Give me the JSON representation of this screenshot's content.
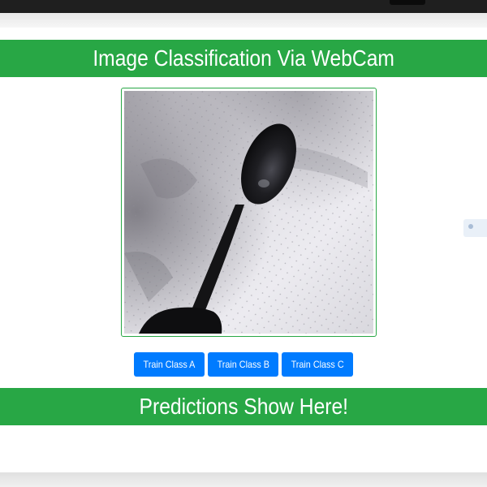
{
  "header": {
    "title": "Image Classification Via WebCam"
  },
  "video": {
    "icon": "webcam-feed"
  },
  "buttons": {
    "train_a": "Train Class A",
    "train_b": "Train Class B",
    "train_c": "Train Class C"
  },
  "predictions": {
    "text": "Predictions Show Here!"
  },
  "colors": {
    "banner_green": "#28a745",
    "button_blue": "#007bff"
  }
}
